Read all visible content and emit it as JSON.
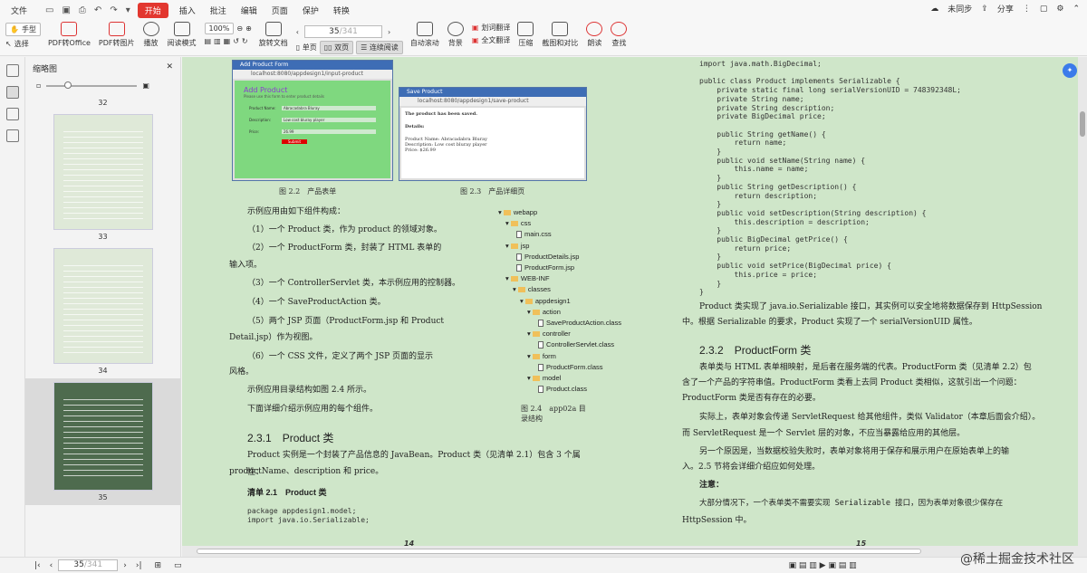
{
  "menubar": {
    "file": "文件",
    "items": [
      "开始",
      "插入",
      "批注",
      "编辑",
      "页面",
      "保护",
      "转换"
    ],
    "sync": "未同步",
    "share": "分享"
  },
  "toolbar": {
    "hand": "手型",
    "select": "选择",
    "pdf_to_office": "PDF转Office",
    "pdf_to_image": "PDF转图片",
    "play": "播放",
    "read_mode": "阅读模式",
    "zoom": "100%",
    "rotate": "旋转文档",
    "single": "单页",
    "double": "双页",
    "continuous": "连续阅读",
    "auto_scroll": "自动滚动",
    "background": "背景",
    "word_translate": "划词翻译",
    "full_translate": "全文翻译",
    "compress": "压缩",
    "screenshot_compare": "截图和对比",
    "read_aloud": "朗读",
    "search": "查找",
    "page_current": "35",
    "page_total": "/341"
  },
  "thumbnail_panel": {
    "title": "缩略图",
    "pages": [
      "32",
      "33",
      "34",
      "35"
    ]
  },
  "document": {
    "left_page": {
      "fig22_window_title": "Add Product Form",
      "fig22_url": "localhost:8080/appdesign1/input-product",
      "fig22_heading": "Add Product",
      "fig22_sub": "Please use this form to enter product details",
      "fig22_labels": [
        "Product Name:",
        "Description:",
        "Price:"
      ],
      "fig22_values": [
        "Abracadabra Bluray",
        "Low cost bluray player",
        "26.99"
      ],
      "fig22_button": "Submit",
      "fig23_window_title": "Save Product",
      "fig23_url": "localhost:8080/appdesign1/save-product",
      "fig23_saved": "The product has been saved.",
      "fig23_details": "Details:",
      "fig23_lines": [
        "Product Name: Abracadabra Bluray",
        "Description: Low cost bluray player",
        "Price: $26.99"
      ],
      "caption_22": "图 2.2　产品表单",
      "caption_23": "图 2.3　产品详细页",
      "p_intro": "示例应用由如下组件构成：",
      "p1": "（1）一个 Product 类，作为 product 的领域对象。",
      "p2a": "（2）一个 ProductForm 类，封装了 HTML 表单的",
      "p2b": "输入项。",
      "p3": "（3）一个 ControllerServlet 类，本示例应用的控制器。",
      "p4": "（4）一个 SaveProductAction 类。",
      "p5a": "（5）两个 JSP 页面（ProductForm.jsp 和 Product",
      "p5b": "Detail.jsp）作为视图。",
      "p6a": "（6）一个 CSS 文件，定义了两个 JSP 页面的显示",
      "p6b": "风格。",
      "p7": "示例应用目录结构如图 2.4 所示。",
      "p8": "下面详细介绍示例应用的每个组件。",
      "tree": [
        "webapp",
        "css",
        "main.css",
        "jsp",
        "ProductDetails.jsp",
        "ProductForm.jsp",
        "WEB-INF",
        "classes",
        "appdesign1",
        "action",
        "SaveProductAction.class",
        "controller",
        "ControllerServlet.class",
        "form",
        "ProductForm.class",
        "model",
        "Product.class"
      ],
      "caption_24": "图 2.4　app02a 目录结构",
      "h231": "2.3.1　Product 类",
      "p9a": "Product 实例是一个封装了产品信息的 JavaBean。Product 类（见清单 2.1）包含 3 个属性：",
      "p9b": "productName、description 和 price。",
      "listing": "清单 2.1　Product 类",
      "code": "package appdesign1.model;\nimport java.io.Serializable;",
      "page_number": "14"
    },
    "right_page": {
      "code": "import java.math.BigDecimal;\n\npublic class Product implements Serializable {\n    private static final long serialVersionUID = 748392348L;\n    private String name;\n    private String description;\n    private BigDecimal price;\n\n    public String getName() {\n        return name;\n    }\n    public void setName(String name) {\n        this.name = name;\n    }\n    public String getDescription() {\n        return description;\n    }\n    public void setDescription(String description) {\n        this.description = description;\n    }\n    public BigDecimal getPrice() {\n        return price;\n    }\n    public void setPrice(BigDecimal price) {\n        this.price = price;\n    }\n}",
      "p1a": "Product 类实现了 java.io.Serializable 接口，其实例可以安全地将数据保存到 HttpSession",
      "p1b": "中。根据 Serializable 的要求，Product 实现了一个 serialVersionUID 属性。",
      "h232": "2.3.2　ProductForm 类",
      "p2a": "表单类与 HTML 表单相映射，是后者在服务端的代表。ProductForm 类（见清单 2.2）包",
      "p2b": "含了一个产品的字符串值。ProductForm 类看上去同 Product 类相似，这就引出一个问题：",
      "p2c": "ProductForm 类是否有存在的必要。",
      "p3a": "实际上，表单对象会传递 ServletRequest 给其他组件，类似 Validator（本章后面会介绍）。",
      "p3b": "而 ServletRequest 是一个 Servlet 层的对象，不应当暴露给应用的其他层。",
      "p4a": "另一个原因是，当数据校验失败时，表单对象将用于保存和展示用户在原始表单上的输",
      "p4b": "入。2.5 节将会详细介绍应如何处理。",
      "note_title": "注意：",
      "note_a": "大部分情况下，一个表单类不需要实现 Serializable 接口，因为表单对象很少保存在",
      "note_b": "HttpSession 中。",
      "page_number": "15"
    }
  },
  "statusbar": {
    "page": "35",
    "total": "/341",
    "watermark": "@稀土掘金技术社区"
  }
}
